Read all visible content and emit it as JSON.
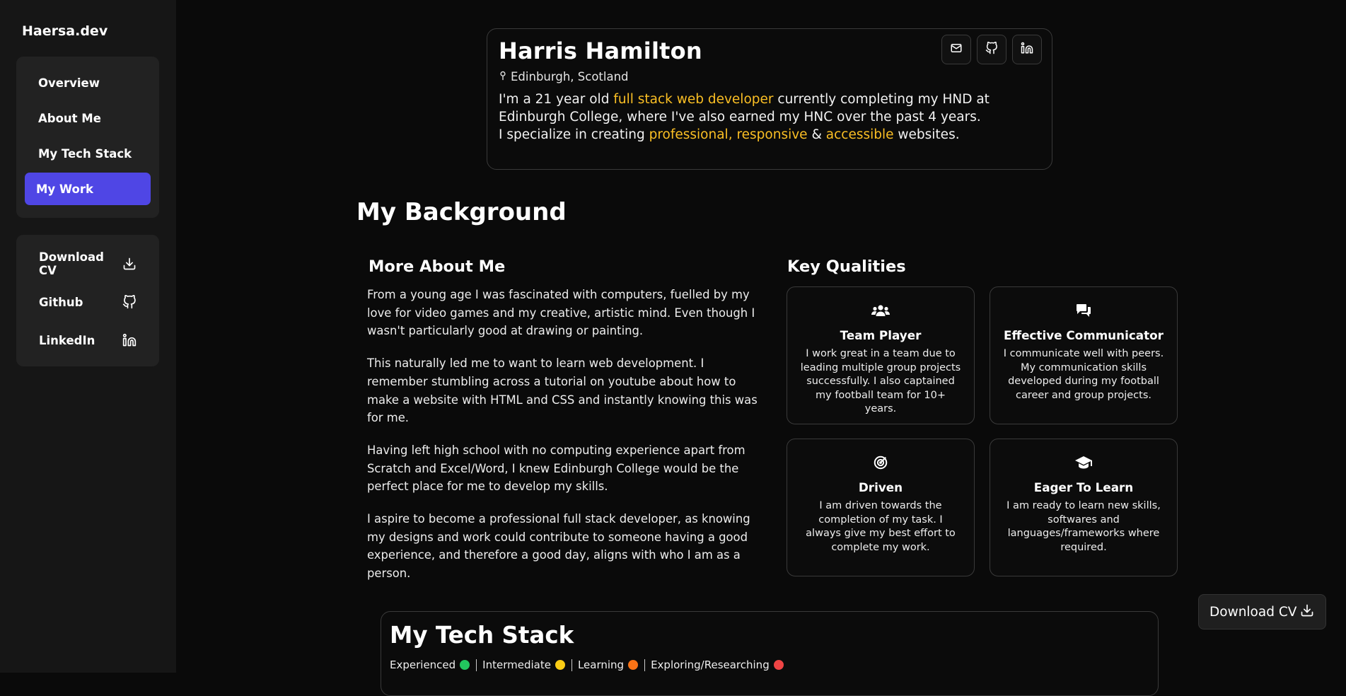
{
  "sidebar": {
    "brand": "Haersa.dev",
    "nav": [
      {
        "label": "Overview"
      },
      {
        "label": "About Me"
      },
      {
        "label": "My Tech Stack"
      },
      {
        "label": "My Work",
        "active": true
      }
    ],
    "links": [
      {
        "label": "Download CV",
        "icon": "download-icon"
      },
      {
        "label": "Github",
        "icon": "github-icon"
      },
      {
        "label": "LinkedIn",
        "icon": "linkedin-icon"
      }
    ]
  },
  "profile": {
    "name": "Harris Hamilton",
    "location": "Edinburgh, Scotland",
    "bio": {
      "p1_a": "I'm a 21 year old ",
      "p1_hl": "full stack web developer",
      "p1_b": " currently completing my HND at Edinburgh College, where I've also earned my HNC over the past 4 years.",
      "p2_a": "I specialize in creating ",
      "p2_hl1": "professional",
      "p2_c1": ", ",
      "p2_hl2": "responsive",
      "p2_c2": " & ",
      "p2_hl3": "accessible",
      "p2_b": " websites."
    },
    "social": [
      "mail-icon",
      "github-icon",
      "linkedin-icon"
    ]
  },
  "background": {
    "title": "My Background",
    "about": {
      "title": "More About Me",
      "paragraphs": [
        "From a young age I was fascinated with computers, fuelled by my love for video games and my creative, artistic mind. Even though I wasn't particularly good at drawing or painting.",
        "This naturally led me to want to learn web development. I remember stumbling across a tutorial on youtube about how to make a website with HTML and CSS and instantly knowing this was for me.",
        "Having left high school with no computing experience apart from Scratch and Excel/Word, I knew Edinburgh College would be the perfect place for me to develop my skills.",
        "I aspire to become a professional full stack developer, as knowing my designs and work could contribute to someone having a good experience, and therefore a good day, aligns with who I am as a person."
      ]
    },
    "qualities": {
      "title": "Key Qualities",
      "items": [
        {
          "title": "Team Player",
          "icon": "users-icon",
          "text": "I work great in a team due to leading multiple group projects successfully. I also captained my football team for 10+ years."
        },
        {
          "title": "Effective Communicator",
          "icon": "chat-icon",
          "text": "I communicate well with peers. My communication skills developed during my football career and group projects."
        },
        {
          "title": "Driven",
          "icon": "target-icon",
          "text": "I am driven towards the completion of my task. I always give my best effort to complete my work."
        },
        {
          "title": "Eager To Learn",
          "icon": "graduation-cap-icon",
          "text": "I am ready to learn new skills, softwares and languages/frameworks where required."
        }
      ]
    }
  },
  "fab": {
    "label": "Download CV",
    "icon": "download-icon"
  },
  "tech": {
    "title": "My Tech Stack",
    "legend": [
      {
        "label": "Experienced",
        "color": "#22c55e"
      },
      {
        "label": "Intermediate",
        "color": "#facc15"
      },
      {
        "label": "Learning",
        "color": "#f97316"
      },
      {
        "label": "Exploring/Researching",
        "color": "#ef4444"
      }
    ]
  },
  "colors": {
    "accent": "#4f46e5",
    "highlight": "#fbbf24"
  }
}
